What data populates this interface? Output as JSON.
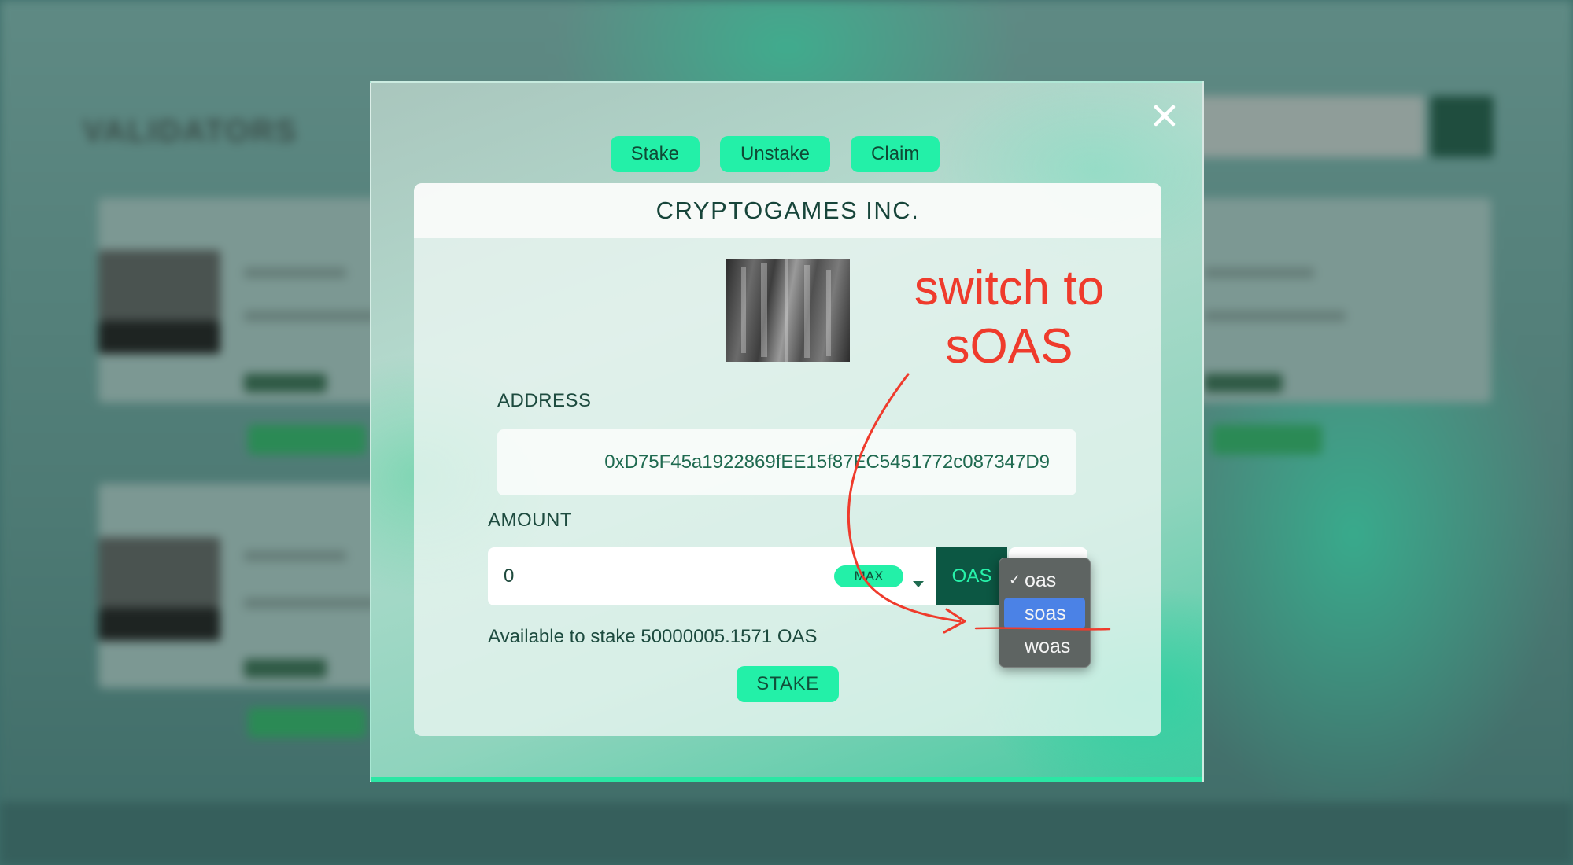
{
  "background": {
    "section_title": "VALIDATORS"
  },
  "modal": {
    "tabs": [
      {
        "label": "Stake"
      },
      {
        "label": "Unstake"
      },
      {
        "label": "Claim"
      }
    ],
    "validator_name": "CRYPTOGAMES INC.",
    "address_label": "ADDRESS",
    "address_value": "0xD75F45a1922869fEE15f87EC5451772c087347D9",
    "amount_label": "AMOUNT",
    "amount_value": "0",
    "max_label": "MAX",
    "token_label": "OAS",
    "available_text": "Available to stake 50000005.1571 OAS",
    "stake_label": "STAKE"
  },
  "dropdown": {
    "options": [
      {
        "label": "oas",
        "checked": true
      },
      {
        "label": "soas",
        "highlighted": true
      },
      {
        "label": "woas"
      }
    ]
  },
  "annotation": {
    "text_line1": "switch to",
    "text_line2": "sOAS",
    "color": "#ef3b2c"
  },
  "colors": {
    "accent": "#23f0a8",
    "dark_green": "#0c5743",
    "text": "#17453a"
  }
}
